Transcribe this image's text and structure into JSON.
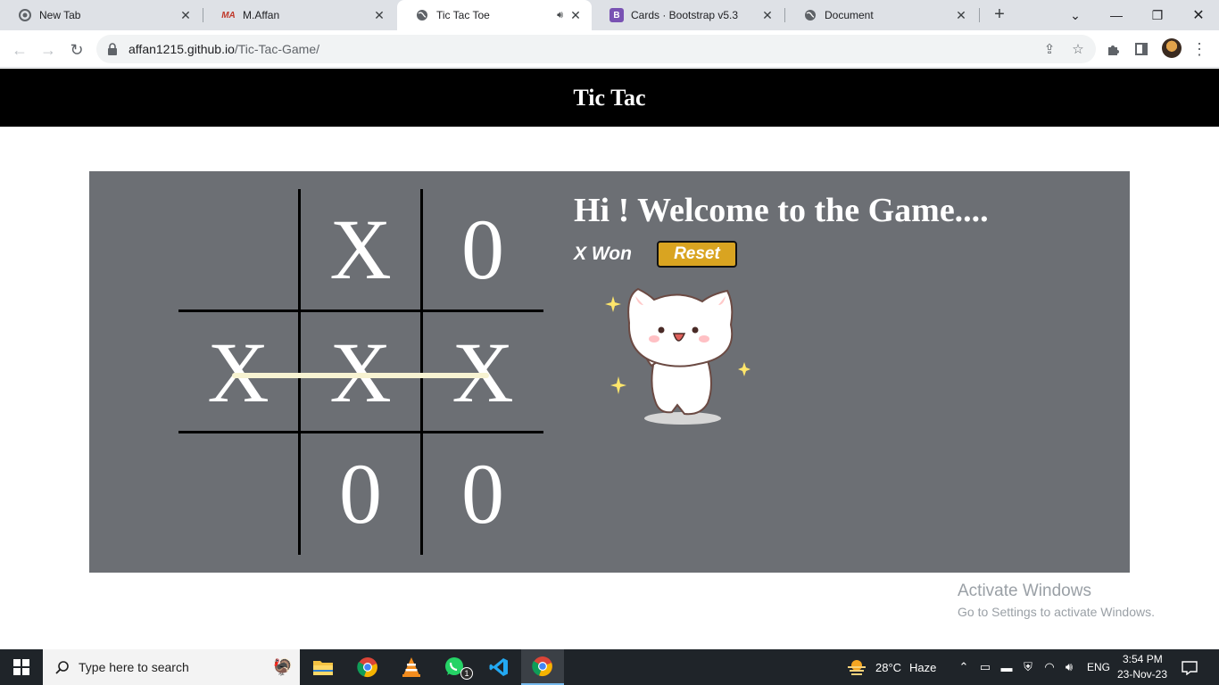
{
  "browser": {
    "tabs": [
      {
        "title": "New Tab",
        "icon": "chrome-icon"
      },
      {
        "title": "M.Affan",
        "icon": "ma-logo-icon"
      },
      {
        "title": "Tic Tac Toe",
        "icon": "globe-icon",
        "active": true,
        "audio": true
      },
      {
        "title": "Cards · Bootstrap v5.3",
        "icon": "bootstrap-icon"
      },
      {
        "title": "Document",
        "icon": "globe-icon"
      }
    ],
    "url_host": "affan1215.github.io",
    "url_path": "/Tic-Tac-Game/"
  },
  "page": {
    "header_title": "Tic Tac",
    "welcome_text": "Hi ! Welcome to the Game....",
    "status_text": "X Won",
    "reset_label": "Reset",
    "board": [
      "",
      "X",
      "0",
      "X",
      "X",
      "X",
      "",
      "0",
      "0"
    ],
    "winning_line": "middle-row",
    "colors": {
      "panel": "#6c6f74",
      "header": "#000000",
      "reset_button": "#d9a421"
    }
  },
  "watermark": {
    "line1": "Activate Windows",
    "line2": "Go to Settings to activate Windows."
  },
  "taskbar": {
    "search_placeholder": "Type here to search",
    "weather_temp": "28°C",
    "weather_desc": "Haze",
    "language": "ENG",
    "time": "3:54 PM",
    "date": "23-Nov-23",
    "whatsapp_badge": "1"
  }
}
